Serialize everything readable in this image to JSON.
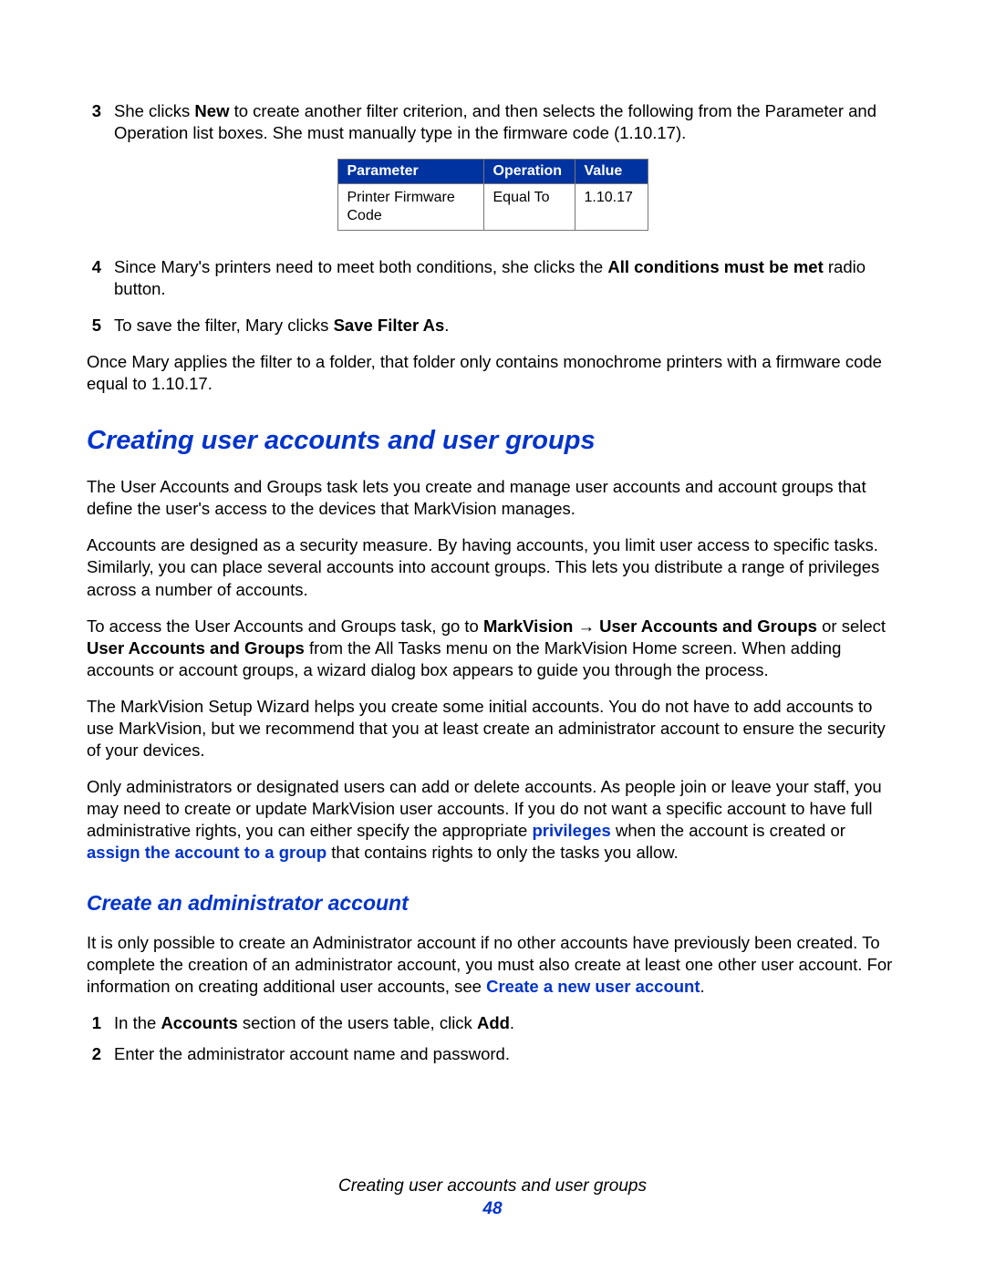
{
  "step3": {
    "num": "3",
    "pre": "She clicks ",
    "bold1": "New",
    "post": " to create another filter criterion, and then selects the following from the Parameter and Operation list boxes. She must manually type in the firmware code (1.10.17)."
  },
  "table": {
    "headers": {
      "c1": "Parameter",
      "c2": "Operation",
      "c3": "Value"
    },
    "row": {
      "c1": "Printer Firmware Code",
      "c2": "Equal To",
      "c3": "1.10.17"
    }
  },
  "step4": {
    "num": "4",
    "pre": "Since Mary's printers need to meet both conditions, she clicks the ",
    "bold1": "All conditions must be met",
    "post": " radio button."
  },
  "step5": {
    "num": "5",
    "pre": "To save the filter, Mary clicks ",
    "bold1": "Save Filter As",
    "post": "."
  },
  "after_list": "Once Mary applies the filter to a folder, that folder only contains monochrome printers with a firmware code equal to 1.10.17.",
  "h2": "Creating user accounts and user groups",
  "p1": "The User Accounts and Groups task lets you create and manage user accounts and account groups that define the user's access to the devices that MarkVision manages.",
  "p2": "Accounts are designed as a security measure. By having accounts, you limit user access to specific tasks. Similarly, you can place several accounts into account groups. This lets you distribute a range of privileges across a number of accounts.",
  "p3": {
    "a": "To access the User Accounts and Groups task, go to ",
    "b": "MarkVision",
    "arrow": " → ",
    "c": "User Accounts and Groups",
    "d": " or select ",
    "e": "User Accounts and Groups",
    "f": " from the All Tasks menu on the MarkVision Home screen. When adding accounts or account groups, a wizard dialog box appears to guide you through the process."
  },
  "p4": "The MarkVision Setup Wizard helps you create some initial accounts. You do not have to add accounts to use MarkVision, but we recommend that you at least create an administrator account to ensure the security of your devices.",
  "p5": {
    "a": "Only administrators or designated users can add or delete accounts. As people join or leave your staff, you may need to create or update MarkVision user accounts. If you do not want a specific account to have full administrative rights, you can either specify the appropriate ",
    "link1": "privileges",
    "b": " when the account is created or ",
    "link2": "assign the account to a group",
    "c": " that contains rights to only the tasks you allow."
  },
  "h3": "Create an administrator account",
  "p6": {
    "a": "It is only possible to create an Administrator account if no other accounts have previously been created. To complete the creation of an administrator account, you must also create at least one other user account. For information on creating additional user accounts, see ",
    "link1": "Create a new user account",
    "b": "."
  },
  "step1b": {
    "num": "1",
    "a": "In the ",
    "b": "Accounts",
    "c": " section of the users table, click ",
    "d": "Add",
    "e": "."
  },
  "step2b": {
    "num": "2",
    "text": "Enter the administrator account name and password."
  },
  "footer": {
    "title": "Creating user accounts and user groups",
    "page": "48"
  }
}
